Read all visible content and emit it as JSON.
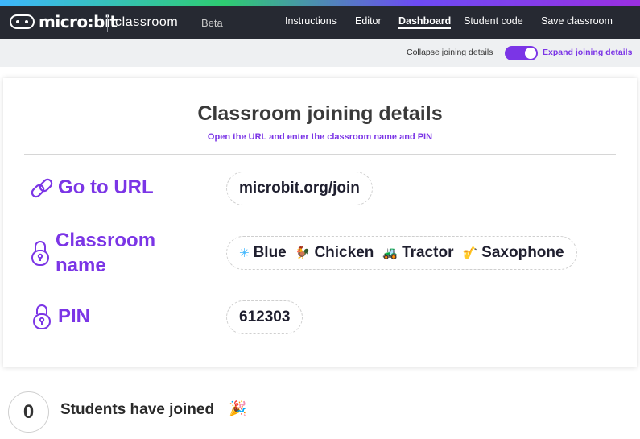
{
  "brand": {
    "logo_text": "micro:bit",
    "app_name": "classroom",
    "separator": "—",
    "beta": "Beta"
  },
  "nav": {
    "instructions": "Instructions",
    "editor": "Editor",
    "dashboard": "Dashboard",
    "student_code": "Student code",
    "save": "Save classroom"
  },
  "subbar": {
    "collapse_label": "Collapse joining details",
    "expand_label": "Expand joining details",
    "expanded": true
  },
  "details": {
    "title": "Classroom joining details",
    "subtitle": "Open the URL and enter the classroom name and PIN",
    "url": {
      "label": "Go to URL",
      "value": "microbit.org/join"
    },
    "classroom": {
      "label_line1": "Classroom",
      "label_line2": "name",
      "words": [
        {
          "icon": "✳",
          "text": "Blue"
        },
        {
          "icon": "🐓",
          "text": "Chicken"
        },
        {
          "icon": "🚜",
          "text": "Tractor"
        },
        {
          "icon": "🎷",
          "text": "Saxophone"
        }
      ]
    },
    "pin": {
      "label": "PIN",
      "value": "612303"
    }
  },
  "students": {
    "count": "0",
    "label": "Students have joined",
    "icon": "🎉"
  },
  "colors": {
    "accent": "#7b35e6",
    "topbar": "#262932"
  }
}
